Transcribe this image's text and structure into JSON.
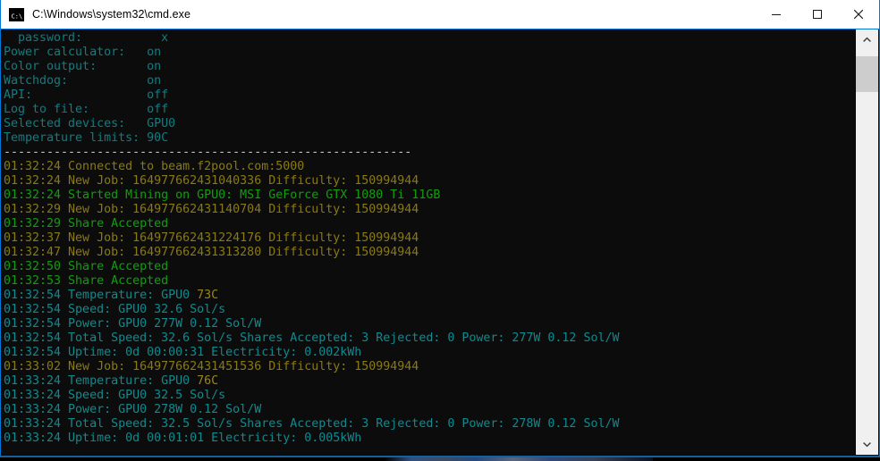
{
  "window": {
    "title": "C:\\Windows\\system32\\cmd.exe",
    "icon": "cmd-console-icon",
    "accent_color": "#0078d7",
    "background_color": "#0c0c0c",
    "controls": {
      "minimize_label": "Minimize",
      "maximize_label": "Maximize",
      "close_label": "Close"
    }
  },
  "colors": {
    "header_teal": "#107d82",
    "log_yellow": "#8a7a12",
    "stat_teal": "#0f8a8f",
    "ok_green": "#129e0c",
    "separator_white": "#cccccc",
    "warn_yellow": "#9a8518"
  },
  "console": {
    "settings": [
      {
        "label": "  password:",
        "value": "x"
      },
      {
        "label": "Power calculator:",
        "value": "on"
      },
      {
        "label": "Color output:",
        "value": "on"
      },
      {
        "label": "Watchdog:",
        "value": "on"
      },
      {
        "label": "API:",
        "value": "off"
      },
      {
        "label": "Log to file:",
        "value": "off"
      },
      {
        "label": "Selected devices:",
        "value": "GPU0"
      },
      {
        "label": "Temperature limits:",
        "value": "90C"
      }
    ],
    "settings_lines": [
      "  password:           x",
      "Power calculator:   on",
      "Color output:       on",
      "Watchdog:           on",
      "API:                off",
      "Log to file:        off",
      "Selected devices:   GPU0",
      "Temperature limits: 90C"
    ],
    "separator": "---------------------------------------------------------",
    "log_lines": [
      {
        "text": "01:32:24 Connected to beam.f2pool.com:5000",
        "color": "log"
      },
      {
        "text": "01:32:24 New Job: 164977662431040336 Difficulty: 150994944",
        "color": "log"
      },
      {
        "text": "01:32:24 Started Mining on GPU0: MSI GeForce GTX 1080 Ti 11GB",
        "color": "ok"
      },
      {
        "text": "01:32:29 New Job: 164977662431140704 Difficulty: 150994944",
        "color": "log"
      },
      {
        "text": "01:32:29 Share Accepted",
        "color": "ok"
      },
      {
        "text": "01:32:37 New Job: 164977662431224176 Difficulty: 150994944",
        "color": "log"
      },
      {
        "text": "01:32:47 New Job: 164977662431313280 Difficulty: 150994944",
        "color": "log"
      },
      {
        "text": "01:32:50 Share Accepted",
        "color": "ok"
      },
      {
        "text": "01:32:53 Share Accepted",
        "color": "ok"
      },
      {
        "text": "01:32:54 Temperature: GPU0 ",
        "color": "stat",
        "suffix": "73C",
        "suffix_color": "warn"
      },
      {
        "text": "01:32:54 Speed: GPU0 32.6 Sol/s",
        "color": "stat"
      },
      {
        "text": "01:32:54 Power: GPU0 277W 0.12 Sol/W",
        "color": "stat"
      },
      {
        "text": "01:32:54 Total Speed: 32.6 Sol/s Shares Accepted: 3 Rejected: 0 Power: 277W 0.12 Sol/W",
        "color": "stat"
      },
      {
        "text": "01:32:54 Uptime: 0d 00:00:31 Electricity: 0.002kWh",
        "color": "stat"
      },
      {
        "text": "01:33:02 New Job: 164977662431451536 Difficulty: 150994944",
        "color": "log"
      },
      {
        "text": "01:33:24 Temperature: GPU0 ",
        "color": "stat",
        "suffix": "76C",
        "suffix_color": "warn"
      },
      {
        "text": "01:33:24 Speed: GPU0 32.5 Sol/s",
        "color": "stat"
      },
      {
        "text": "01:33:24 Power: GPU0 278W 0.12 Sol/W",
        "color": "stat"
      },
      {
        "text": "01:33:24 Total Speed: 32.5 Sol/s Shares Accepted: 3 Rejected: 0 Power: 278W 0.12 Sol/W",
        "color": "stat"
      },
      {
        "text": "01:33:24 Uptime: 0d 00:01:01 Electricity: 0.005kWh",
        "color": "stat"
      }
    ]
  },
  "scrollbar": {
    "up_arrow": "chevron-up-icon",
    "down_arrow": "chevron-down-icon",
    "thumb_position_percent": 2
  }
}
